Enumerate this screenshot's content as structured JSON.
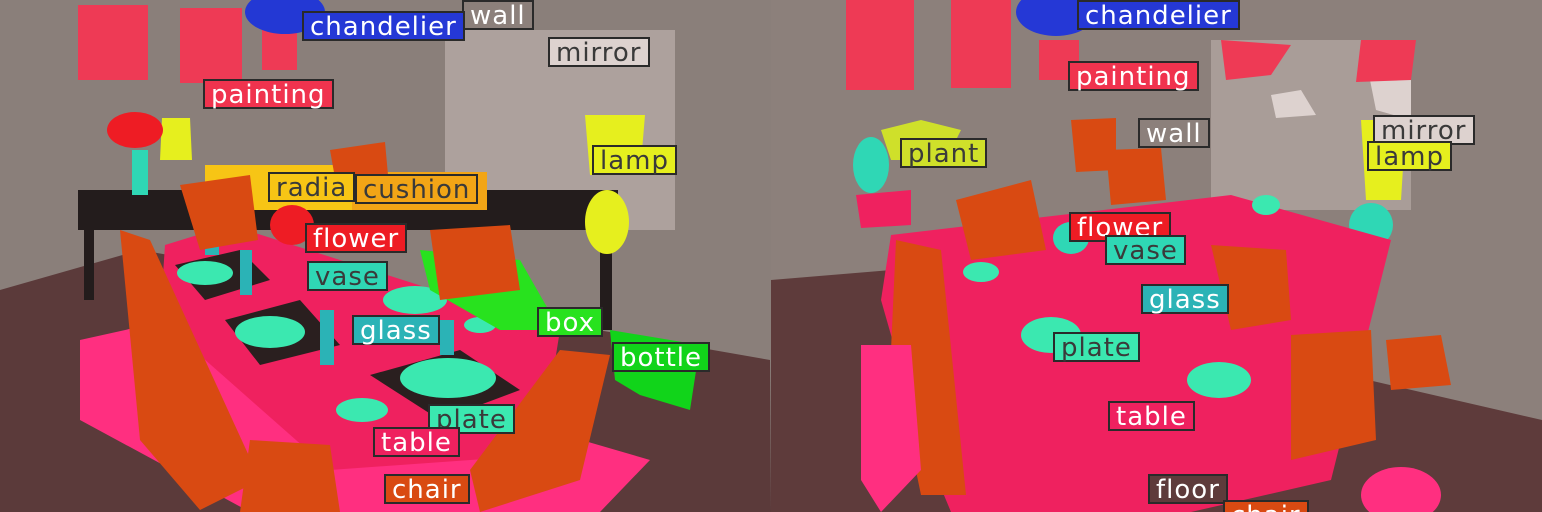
{
  "colors": {
    "wall": "#8c807b",
    "floor": "#5e3b3b",
    "painting": "#f0334e",
    "chandelier": "#2538d6",
    "lamp": "#e6ef1e",
    "plant": "#cfe02a",
    "cushion": "#f2a516",
    "radiator": "#f7c515",
    "flower": "#ee1c24",
    "vase": "#2fd7b5",
    "glass": "#2bb3b6",
    "plate": "#3be8b0",
    "table": "#ef215f",
    "chair": "#d94a12",
    "box": "#28e21e",
    "bottle": "#11d41a",
    "mirror": "#ddd2cf",
    "rug": "#ff2f80",
    "cabinet": "#231c1c"
  },
  "left_panel": {
    "labels": [
      {
        "id": "wall",
        "text": "wall"
      },
      {
        "id": "chandelier",
        "text": "chandelier"
      },
      {
        "id": "mirror",
        "text": "mirror"
      },
      {
        "id": "painting",
        "text": "painting"
      },
      {
        "id": "lamp",
        "text": "lamp"
      },
      {
        "id": "radiator",
        "text": "radia"
      },
      {
        "id": "cushion",
        "text": "cushion"
      },
      {
        "id": "flower",
        "text": "flower"
      },
      {
        "id": "vase",
        "text": "vase"
      },
      {
        "id": "box",
        "text": "box"
      },
      {
        "id": "glass",
        "text": "glass"
      },
      {
        "id": "bottle",
        "text": "bottle"
      },
      {
        "id": "plate",
        "text": "plate"
      },
      {
        "id": "table",
        "text": "table"
      },
      {
        "id": "chair",
        "text": "chair"
      }
    ]
  },
  "right_panel": {
    "labels": [
      {
        "id": "chandelier",
        "text": "chandelier"
      },
      {
        "id": "painting",
        "text": "painting"
      },
      {
        "id": "wall",
        "text": "wall"
      },
      {
        "id": "mirror",
        "text": "mirror"
      },
      {
        "id": "plant",
        "text": "plant"
      },
      {
        "id": "lamp",
        "text": "lamp"
      },
      {
        "id": "flower",
        "text": "flower"
      },
      {
        "id": "vase",
        "text": "vase"
      },
      {
        "id": "glass",
        "text": "glass"
      },
      {
        "id": "plate",
        "text": "plate"
      },
      {
        "id": "table",
        "text": "table"
      },
      {
        "id": "floor",
        "text": "floor"
      },
      {
        "id": "chair",
        "text": "chair"
      }
    ]
  }
}
